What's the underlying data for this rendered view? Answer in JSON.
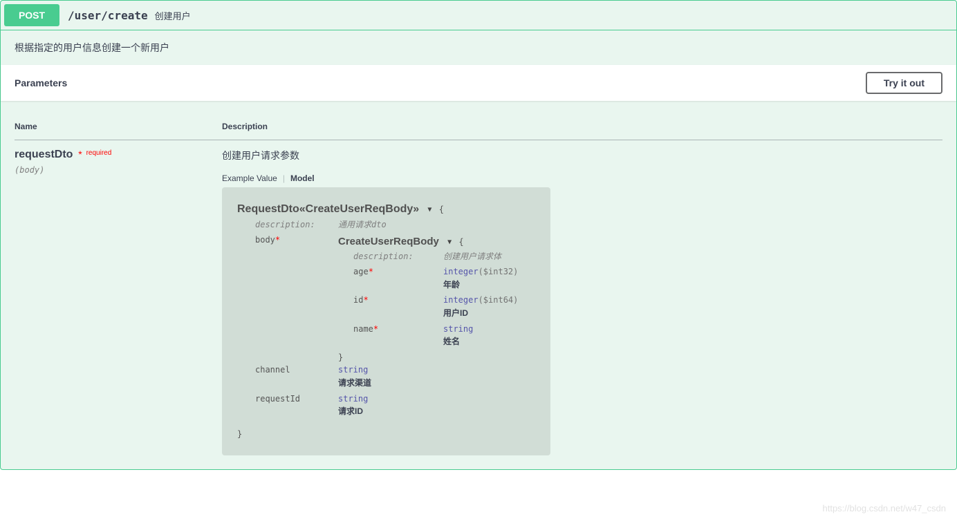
{
  "op": {
    "method": "POST",
    "path": "/user/create",
    "summary": "创建用户",
    "description": "根据指定的用户信息创建一个新用户"
  },
  "section": {
    "parameters_label": "Parameters",
    "try_label": "Try it out",
    "col_name": "Name",
    "col_desc": "Description"
  },
  "param": {
    "name": "requestDto",
    "required_label": "required",
    "in": "(body)",
    "description": "创建用户请求参数"
  },
  "tabs": {
    "example": "Example Value",
    "model": "Model"
  },
  "model": {
    "title": "RequestDto«CreateUserReqBody»",
    "desc_key": "description:",
    "desc_val": "通用请求dto",
    "body": {
      "key": "body",
      "title": "CreateUserReqBody",
      "desc_key": "description:",
      "desc_val": "创建用户请求体",
      "fields": {
        "age": {
          "key": "age",
          "type": "integer",
          "fmt": "($int32)",
          "desc": "年龄"
        },
        "id": {
          "key": "id",
          "type": "integer",
          "fmt": "($int64)",
          "desc": "用户ID"
        },
        "name": {
          "key": "name",
          "type": "string",
          "fmt": "",
          "desc": "姓名"
        }
      }
    },
    "channel": {
      "key": "channel",
      "type": "string",
      "desc": "请求渠道"
    },
    "requestId": {
      "key": "requestId",
      "type": "string",
      "desc": "请求ID"
    }
  },
  "watermark": "https://blog.csdn.net/w47_csdn"
}
